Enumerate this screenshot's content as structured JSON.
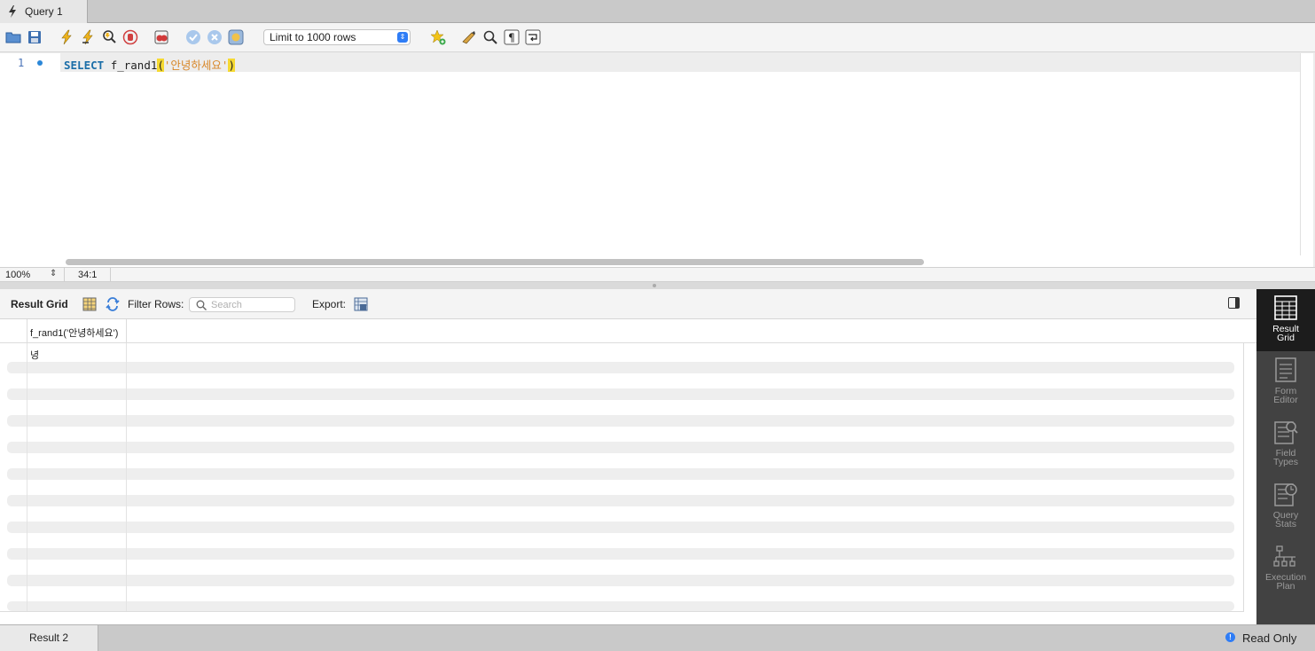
{
  "tab": {
    "title": "Query 1"
  },
  "toolbar": {
    "icons": [
      "open-folder-icon",
      "save-icon",
      "execute-icon",
      "execute-current-icon",
      "explain-icon",
      "stop-icon",
      "toggle-error-icon",
      "commit-icon",
      "rollback-icon",
      "autocommit-icon",
      "add-snippet-icon",
      "beautify-icon",
      "find-icon",
      "invisible-chars-icon",
      "wrap-icon"
    ],
    "limit_select": "Limit to 1000 rows"
  },
  "editor": {
    "line_number": "1",
    "code": {
      "keyword": "SELECT",
      "function": "f_rand1",
      "open_paren": "(",
      "string": "'안녕하세요'",
      "close_paren": ")"
    }
  },
  "status": {
    "zoom": "100%",
    "cursor": "34:1"
  },
  "result_toolbar": {
    "title": "Result Grid",
    "filter_label": "Filter Rows:",
    "search_placeholder": "Search",
    "export_label": "Export:"
  },
  "grid": {
    "columns": [
      "f_rand1('안녕하세요')"
    ],
    "rows": [
      [
        "녕"
      ]
    ]
  },
  "side_panel": [
    {
      "label_line1": "Result",
      "label_line2": "Grid",
      "active": true
    },
    {
      "label_line1": "Form",
      "label_line2": "Editor",
      "active": false
    },
    {
      "label_line1": "Field",
      "label_line2": "Types",
      "active": false
    },
    {
      "label_line1": "Query",
      "label_line2": "Stats",
      "active": false
    },
    {
      "label_line1": "Execution",
      "label_line2": "Plan",
      "active": false
    }
  ],
  "bottom": {
    "result_tab": "Result 2",
    "read_only": "Read Only"
  },
  "colors": {
    "accent": "#2f7df6",
    "keyword": "#1b6ea8",
    "string": "#d8882a",
    "bracket_highlight": "#f5d931"
  }
}
